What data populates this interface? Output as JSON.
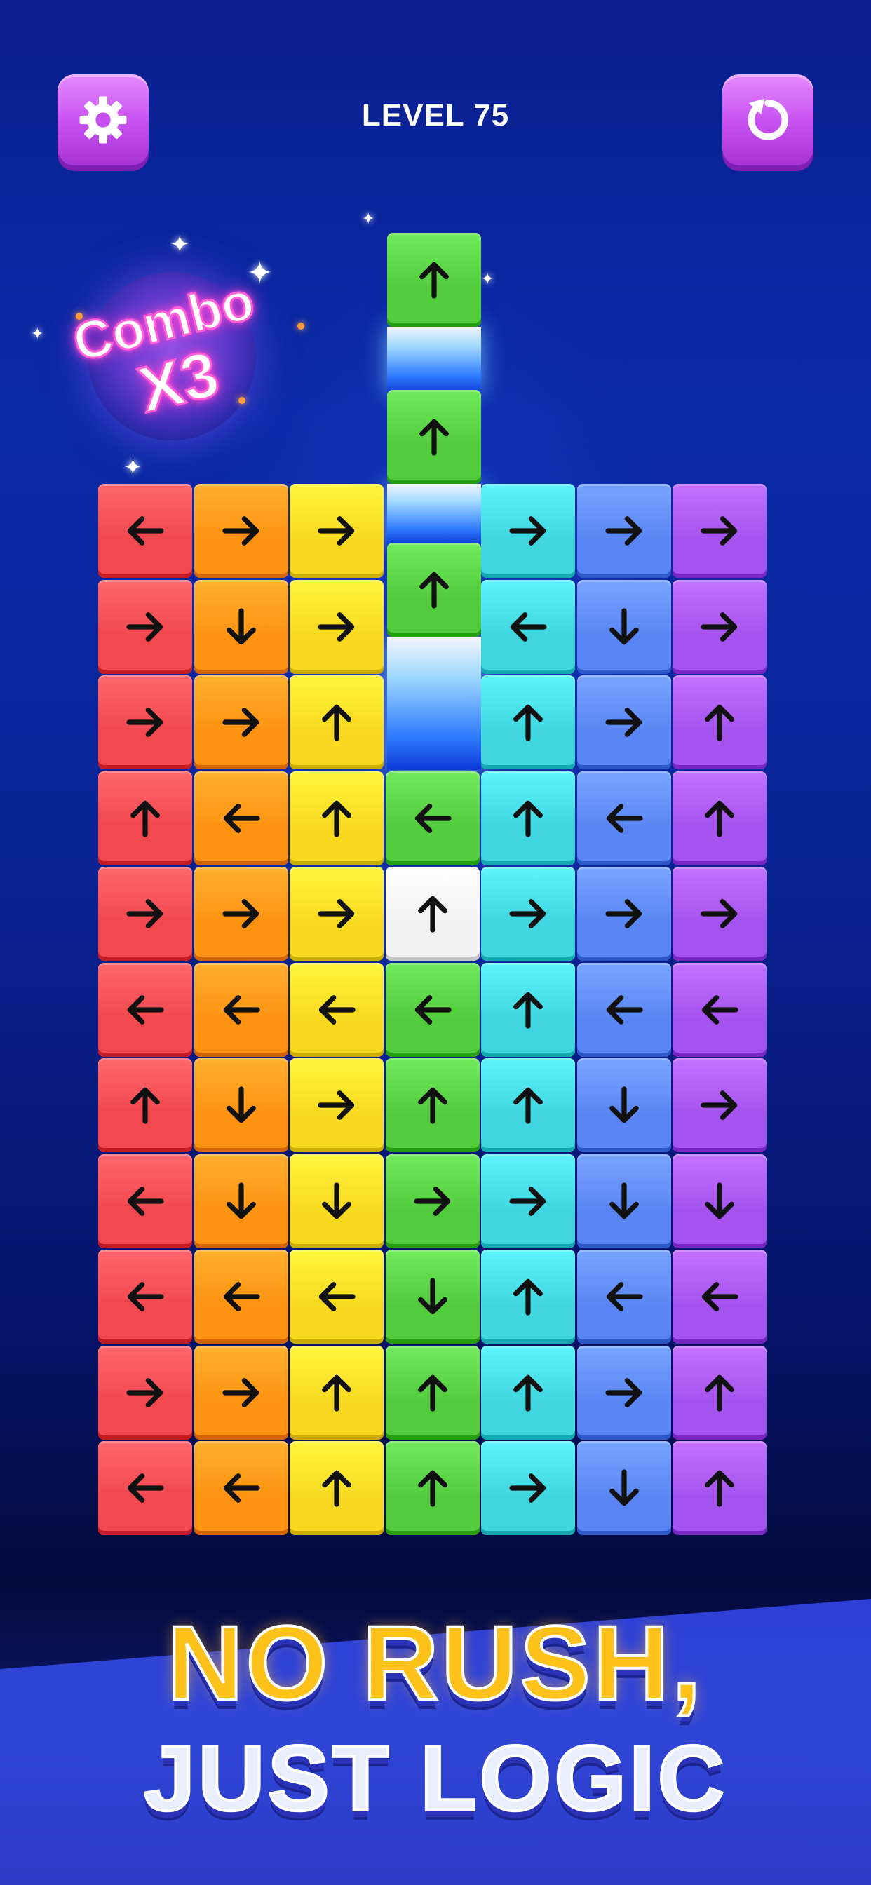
{
  "header": {
    "level_label": "LEVEL 75",
    "settings_icon": "gear-icon",
    "restart_icon": "restart-icon"
  },
  "combo": {
    "word": "Combo",
    "multiplier": "X3"
  },
  "banner": {
    "line1": "NO RUSH,",
    "line2": "JUST LOGIC"
  },
  "colors": {
    "red": "#f2484f",
    "orange": "#ff9211",
    "yellow": "#f8d91f",
    "green": "#52cc3c",
    "cyan": "#3fd6df",
    "blue": "#5a86f5",
    "purple": "#a553ef",
    "white": "#f2f2f2",
    "button_purple": "#c64ff0",
    "title_orange": "#ffc21a"
  },
  "column_colors": [
    "red",
    "orange",
    "yellow",
    "green",
    "cyan",
    "blue",
    "purple"
  ],
  "grid": [
    [
      "left",
      "right",
      "right",
      null,
      "right",
      "right",
      "right"
    ],
    [
      "right",
      "down",
      "right",
      null,
      "left",
      "down",
      "right"
    ],
    [
      "right",
      "right",
      "up",
      null,
      "up",
      "right",
      "up"
    ],
    [
      "up",
      "left",
      "up",
      "left",
      "up",
      "left",
      "up"
    ],
    [
      "right",
      "right",
      "right",
      "up",
      "right",
      "right",
      "right"
    ],
    [
      "left",
      "left",
      "left",
      "left",
      "up",
      "left",
      "left"
    ],
    [
      "up",
      "down",
      "right",
      "up",
      "up",
      "down",
      "right"
    ],
    [
      "left",
      "down",
      "down",
      "right",
      "right",
      "down",
      "down"
    ],
    [
      "left",
      "left",
      "left",
      "down",
      "up",
      "left",
      "left"
    ],
    [
      "right",
      "right",
      "up",
      "up",
      "up",
      "right",
      "up"
    ],
    [
      "left",
      "left",
      "up",
      "up",
      "right",
      "down",
      "up"
    ]
  ],
  "highlighted_tile": {
    "row": 4,
    "col": 3
  },
  "moving_tiles": [
    {
      "color": "green",
      "direction": "up"
    },
    {
      "color": "green",
      "direction": "up"
    },
    {
      "color": "green",
      "direction": "up"
    }
  ]
}
